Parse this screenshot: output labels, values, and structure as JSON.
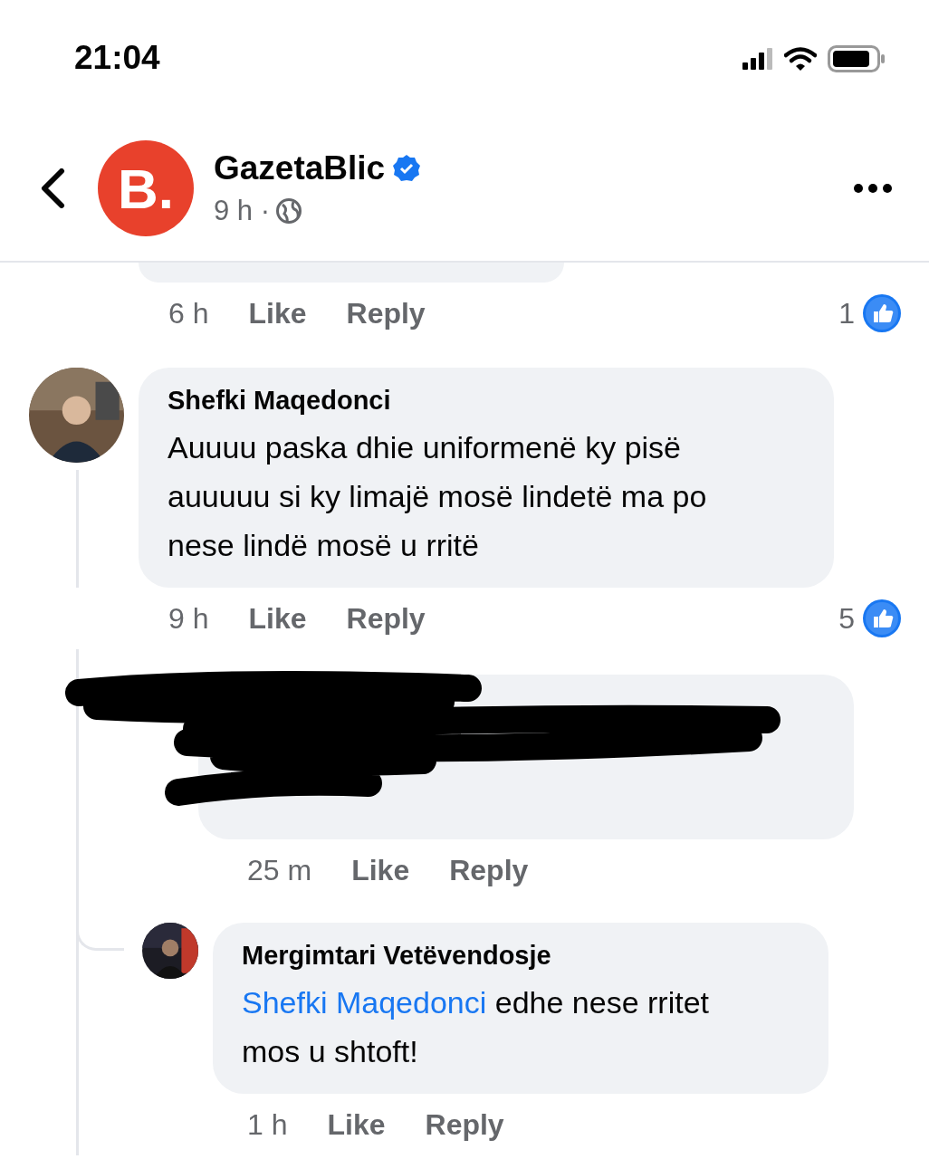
{
  "status_bar": {
    "time": "21:04"
  },
  "header": {
    "logo": "B.",
    "page_name": "GazetaBlic",
    "verified": true,
    "time": "9 h ·"
  },
  "comments": [
    {
      "kind": "cut",
      "time": "6 h",
      "like": "Like",
      "reply": "Reply",
      "reactions": "1"
    },
    {
      "kind": "comment",
      "author": "Shefki Maqedonci",
      "text": "Auuuu paska dhie uniformenë ky pisë auuuuu si ky limajë mosë lindetë ma po nese lindë mosë u rritë",
      "time": "9 h",
      "like": "Like",
      "reply": "Reply",
      "reactions": "5",
      "replies": [
        {
          "kind": "redacted",
          "time": "25 m",
          "like": "Like",
          "reply": "Reply"
        },
        {
          "kind": "reply",
          "author": "Mergimtari Vetëvendosje",
          "mention": "Shefki Maqedonci",
          "text": "edhe nese rritet mos u shtoft!",
          "time": "1 h",
          "like": "Like",
          "reply": "Reply"
        }
      ]
    }
  ]
}
